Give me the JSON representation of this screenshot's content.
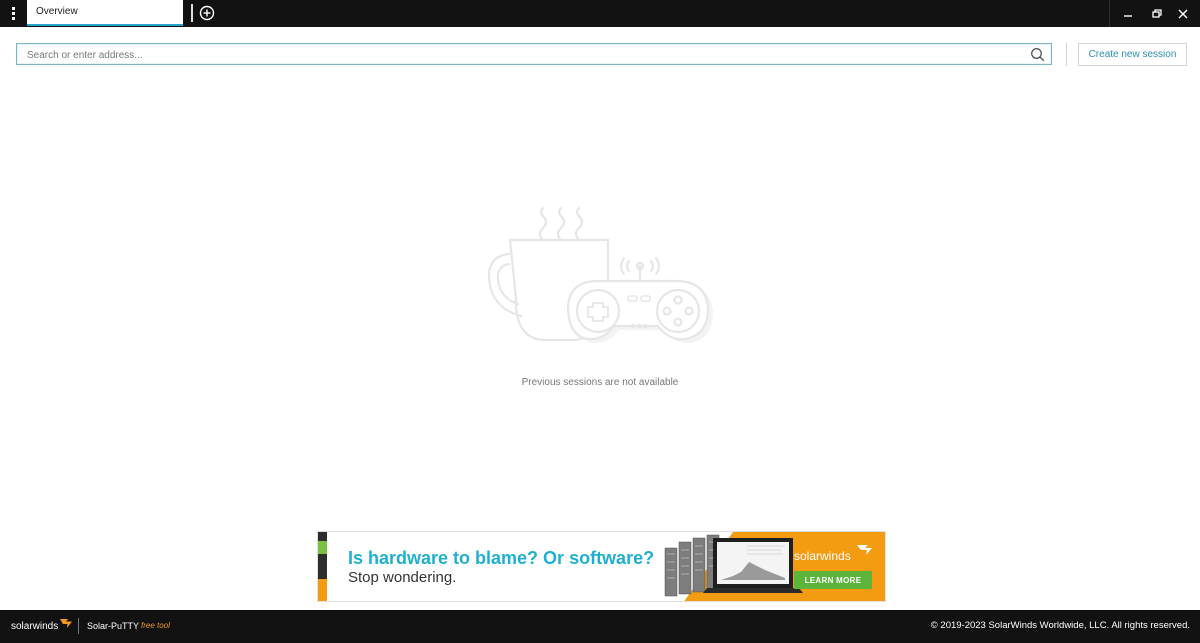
{
  "window": {
    "menu_icon": "kebab-menu-icon",
    "tabs": [
      {
        "label": "Overview",
        "active": true
      }
    ],
    "add_tab_icon": "plus-circle-icon",
    "controls": {
      "minimize_icon": "minimize-icon",
      "restore_icon": "restore-icon",
      "close_icon": "close-icon"
    }
  },
  "search": {
    "placeholder": "Search or enter address...",
    "value": "",
    "icon": "search-icon"
  },
  "toolbar": {
    "create_label": "Create new session"
  },
  "empty_state": {
    "illustration": "coffee-cup-and-gamepad-illustration",
    "message": "Previous sessions are not available"
  },
  "ad": {
    "headline": "Is hardware to blame? Or software?",
    "subline": "Stop wondering.",
    "brand": "solarwinds",
    "cta": "LEARN MORE",
    "colors": {
      "headline": "#1fb0d0",
      "panel": "#f39c12",
      "cta": "#5cb53a"
    }
  },
  "footer": {
    "brand": "solarwinds",
    "product": "Solar-PuTTY",
    "tag": "free tool",
    "copyright": "© 2019-2023 SolarWinds Worldwide, LLC. All rights reserved."
  },
  "colors": {
    "accent": "#27a2c8",
    "titlebar": "#121212",
    "link": "#2a8db3",
    "tag": "#f29a1f"
  }
}
